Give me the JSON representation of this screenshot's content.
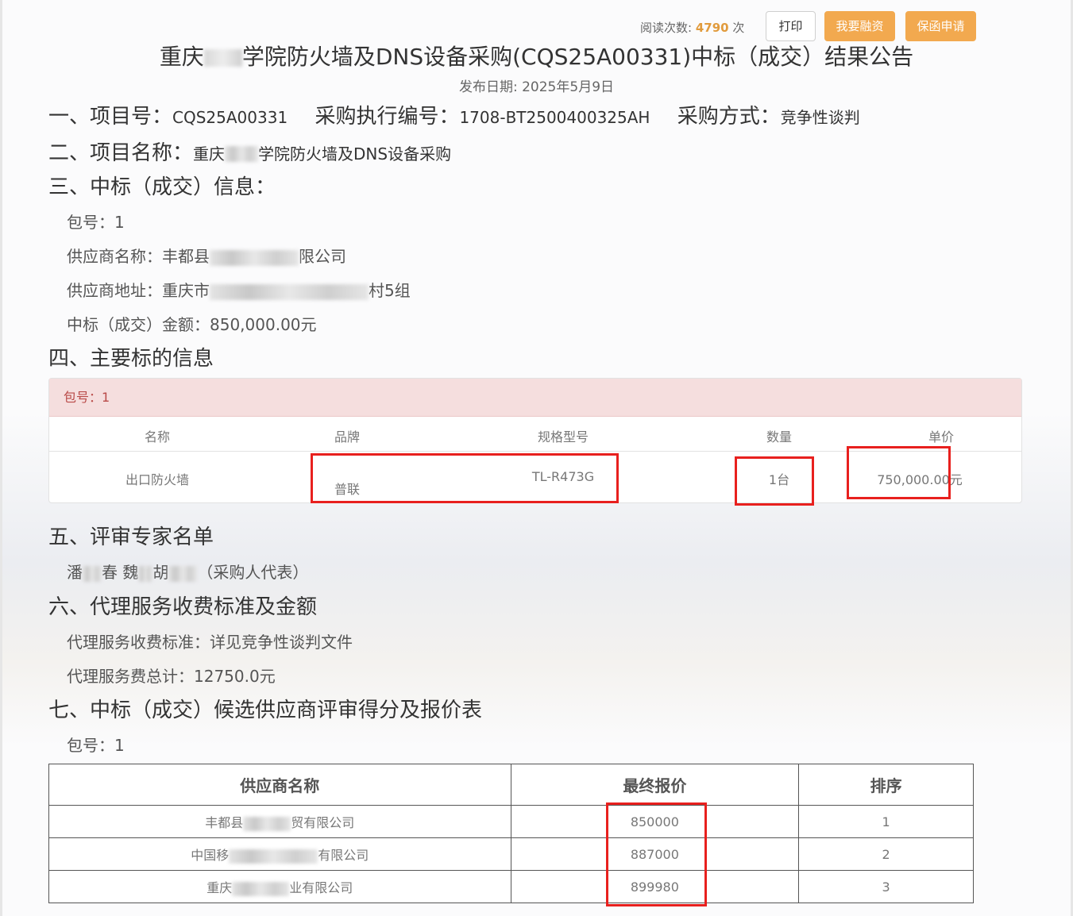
{
  "toolbar": {
    "read_label": "阅读次数:",
    "read_count": "4790",
    "read_unit": "次",
    "print": "打印",
    "finance": "我要融资",
    "guarantee": "保函申请"
  },
  "notice": {
    "title_part1": "重庆",
    "title_part2": "学院防火墙及DNS设备采购(CQS25A00331)中标（成交）结果公告",
    "publish_label": "发布日期:",
    "publish_date": "2025年5月9日"
  },
  "section1": {
    "project_no_label": "一、项目号：",
    "project_no": "CQS25A00331",
    "exec_no_label": "采购执行编号：",
    "exec_no": "1708-BT2500400325AH",
    "method_label": "采购方式：",
    "method": "竞争性谈判"
  },
  "section2": {
    "label": "二、项目名称：",
    "name_part1": "重庆",
    "name_part2": "学院防火墙及DNS设备采购"
  },
  "section3": {
    "heading": "三、中标（成交）信息：",
    "package": "包号：1",
    "supplier_name_label": "供应商名称：",
    "supplier_name_part1": "丰都县",
    "supplier_name_part2": "限公司",
    "supplier_addr_label": "供应商地址：",
    "supplier_addr_part1": "重庆市",
    "supplier_addr_part2": "村5组",
    "amount_label": "中标（成交）金额：",
    "amount": "850,000.00元"
  },
  "section4": {
    "heading": "四、主要标的信息",
    "package": "包号：1",
    "columns": [
      "名称",
      "品牌",
      "规格型号",
      "数量",
      "单价"
    ],
    "row": [
      "出口防火墙",
      "普联",
      "TL-R473G",
      "1台",
      "750,000.00元"
    ]
  },
  "section5": {
    "heading": "五、评审专家名单",
    "experts_part1": "潘",
    "experts_part2": "春 魏",
    "experts_part3": "胡",
    "experts_part4": "（采购人代表）"
  },
  "section6": {
    "heading": "六、代理服务收费标准及金额",
    "standard": "代理服务收费标准：详见竞争性谈判文件",
    "total": "代理服务费总计：12750.0元"
  },
  "section7": {
    "heading": "七、中标（成交）候选供应商评审得分及报价表",
    "package": "包号：1",
    "columns": [
      "供应商名称",
      "最终报价",
      "排序"
    ],
    "rows": [
      {
        "name_a": "丰都县",
        "name_b": "贸有限公司",
        "price": "850000",
        "rank": "1"
      },
      {
        "name_a": "中国移",
        "name_b": "有限公司",
        "price": "887000",
        "rank": "2"
      },
      {
        "name_a": "重庆",
        "name_b": "业有限公司",
        "price": "899980",
        "rank": "3"
      }
    ]
  },
  "colors": {
    "accent": "#f2a94f",
    "read_count": "#e19b3d",
    "highlight_box": "#e8201e",
    "package_header_bg": "#f5dede"
  }
}
